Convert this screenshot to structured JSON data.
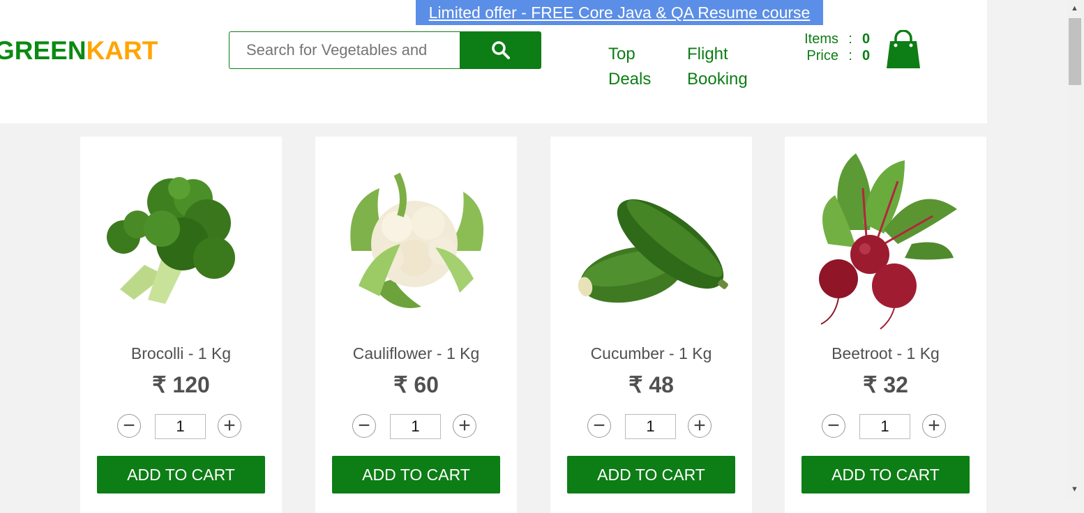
{
  "offer_banner": {
    "text": "Limited offer - FREE Core Java & QA Resume course"
  },
  "logo": {
    "part1": "GREEN",
    "part2": "KART"
  },
  "search": {
    "placeholder": "Search for Vegetables and Fruits",
    "icon": "search-icon"
  },
  "nav": [
    {
      "label": "Top\nDeals"
    },
    {
      "label": "Flight\nBooking"
    }
  ],
  "cart": {
    "items_label": "Items",
    "items_value": "0",
    "price_label": "Price",
    "price_value": "0",
    "separator": ":",
    "icon": "shopping-bag-icon"
  },
  "products": [
    {
      "name": "Brocolli - 1 Kg",
      "price": "₹ 120",
      "qty": "1",
      "button": "ADD TO CART",
      "decrement": "−",
      "increment": "+"
    },
    {
      "name": "Cauliflower - 1 Kg",
      "price": "₹ 60",
      "qty": "1",
      "button": "ADD TO CART",
      "decrement": "−",
      "increment": "+"
    },
    {
      "name": "Cucumber - 1 Kg",
      "price": "₹ 48",
      "qty": "1",
      "button": "ADD TO CART",
      "decrement": "−",
      "increment": "+"
    },
    {
      "name": "Beetroot - 1 Kg",
      "price": "₹ 32",
      "qty": "1",
      "button": "ADD TO CART",
      "decrement": "−",
      "increment": "+"
    }
  ],
  "colors": {
    "brand_green": "#0d7d15",
    "brand_orange": "#ffa500",
    "banner_blue": "#5b8ee6"
  }
}
